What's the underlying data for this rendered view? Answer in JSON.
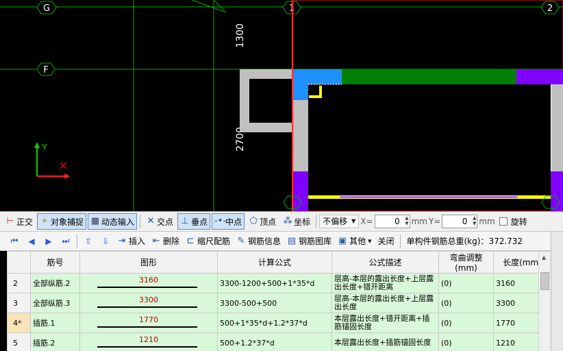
{
  "cad": {
    "axes": {
      "g": "G",
      "f": "F",
      "a1": "1",
      "a2": "2"
    },
    "dims": {
      "d1300": "1300",
      "d2700": "2700"
    },
    "ucs": {
      "y": "Y"
    },
    "colors": {
      "background": "#000000",
      "grid_line": "#00c000",
      "red_box": "#ff0000",
      "wall_gray": "#c0c0c0",
      "beam_green": "#008000",
      "column_blue": "#1e90ff",
      "column_purple": "#8000ff",
      "rebar_yellow": "#ffff00"
    }
  },
  "snapbar": {
    "ortho": "正交",
    "object_snap": "对象捕捉",
    "dynamic_input": "动态输入",
    "intersection": "交点",
    "perpendicular": "垂点",
    "midpoint": "中点",
    "vertex": "顶点",
    "coordinate": "坐标",
    "offset_mode": "不偏移",
    "x_label": "X=",
    "x_value": "0",
    "y_label": "Y=",
    "y_value": "0",
    "unit": "mm",
    "rotate": "旋转"
  },
  "rebarbar": {
    "insert": "插入",
    "delete": "删除",
    "scale_rebar": "缩尺配筋",
    "rebar_info": "钢筋信息",
    "rebar_library": "钢筋图库",
    "other": "其他",
    "close": "关闭",
    "total_label": "单构件钢筋总重(kg)：",
    "total_value": "372.732"
  },
  "table": {
    "headers": [
      "筋号",
      "图形",
      "计算公式",
      "公式描述",
      "弯曲调整(mm)",
      "长度(mm)"
    ],
    "rows": [
      {
        "num": "2",
        "name": "全部纵筋.2",
        "shape": "3160",
        "formula": "3300-1200+500+1*35*d",
        "desc": "层高-本层的露出长度+上层露出长度+错开距离",
        "bend": "(0)",
        "length": "3160"
      },
      {
        "num": "3",
        "name": "全部纵筋.3",
        "shape": "3300",
        "formula": "3300-500+500",
        "desc": "层高-本层的露出长度+上层露出长度",
        "bend": "(0)",
        "length": "3300"
      },
      {
        "num": "4*",
        "name": "插筋.1",
        "shape": "1770",
        "formula": "500+1*35*d+1.2*37*d",
        "desc": "本层露出长度+错开距离+插筋锚固长度",
        "bend": "(0)",
        "length": "1770"
      },
      {
        "num": "5",
        "name": "插筋.2",
        "shape": "1210",
        "formula": "500+1.2*37*d",
        "desc": "本层露出长度+插筋锚固长度",
        "bend": "(0)",
        "length": "1210"
      }
    ]
  }
}
